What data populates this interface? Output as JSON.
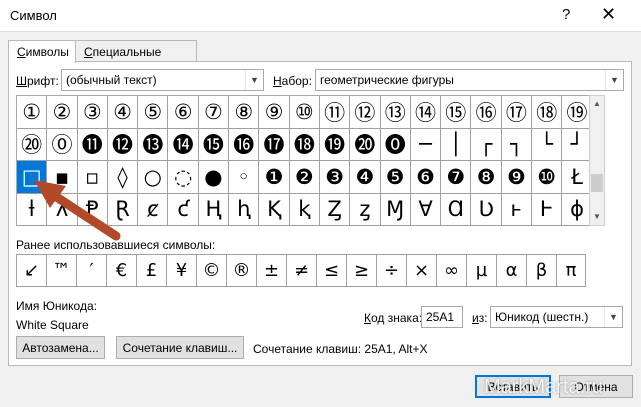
{
  "window": {
    "title": "Символ",
    "help": "?",
    "close": "✕"
  },
  "tabs": [
    {
      "label_ul": "С",
      "label_rest": "имволы"
    },
    {
      "label_ul": "С",
      "label_rest": "пециальные знаки"
    }
  ],
  "font": {
    "label_ul": "Ш",
    "label_rest": "рифт:",
    "value": "(обычный текст)"
  },
  "subset": {
    "label_ul": "Н",
    "label_rest": "абор:",
    "value": "геометрические фигуры"
  },
  "grid": {
    "rows": [
      [
        "①",
        "②",
        "③",
        "④",
        "⑤",
        "⑥",
        "⑦",
        "⑧",
        "⑨",
        "⑩",
        "⑪",
        "⑫",
        "⑬",
        "⑭",
        "⑮",
        "⑯",
        "⑰",
        "⑱",
        "⑲"
      ],
      [
        "⑳",
        "⓪",
        "⓫",
        "⓬",
        "⓭",
        "⓮",
        "⓯",
        "⓰",
        "⓱",
        "⓲",
        "⓳",
        "⓴",
        "⓿",
        "─",
        "│",
        "┌",
        "┐",
        "└",
        "┘"
      ],
      [
        "□",
        "▪",
        "▫",
        "◊",
        "○",
        "◌",
        "●",
        "◦",
        "❶",
        "❷",
        "❸",
        "❹",
        "❺",
        "❻",
        "❼",
        "❽",
        "❾",
        "❿",
        "Ł"
      ],
      [
        "ƚ",
        "ƛ",
        "Ᵽ",
        "Ɽ",
        "ȼ",
        "ƈ",
        "Ⱨ",
        "ⱨ",
        "Ⱪ",
        "ⱪ",
        "Ȥ",
        "ȥ",
        "Ɱ",
        "Ɐ",
        "Ɑ",
        "Ʋ",
        "ⱶ",
        "Ⱶ",
        "ɸ"
      ]
    ],
    "selected_row": 2,
    "selected_col": 0
  },
  "recent": {
    "label": "Ранее использовавшиеся символы:",
    "symbols": [
      "↙",
      "™",
      "′",
      "€",
      "£",
      "¥",
      "©",
      "®",
      "±",
      "≠",
      "≤",
      "≥",
      "÷",
      "×",
      "∞",
      "µ",
      "α",
      "β",
      "π"
    ]
  },
  "unicode_name": {
    "label": "Имя Юникода:",
    "value": "White Square"
  },
  "char_code": {
    "label_ul": "К",
    "label_rest": "од знака:",
    "value": "25A1"
  },
  "from": {
    "label_ul": "и",
    "label_rest": "з:",
    "value": "Юникод (шестн.)"
  },
  "buttons": {
    "autocorrect": "Автозамена...",
    "shortcut_key": "Сочетание клавиш...",
    "insert": "Вставить",
    "cancel": "Отмена"
  },
  "shortcut_info": "Сочетание клавиш: 25A1, Alt+X",
  "watermark": "MarkMarta.ru",
  "colors": {
    "selection": "#0078d7",
    "arrow": "#b24a2a"
  }
}
